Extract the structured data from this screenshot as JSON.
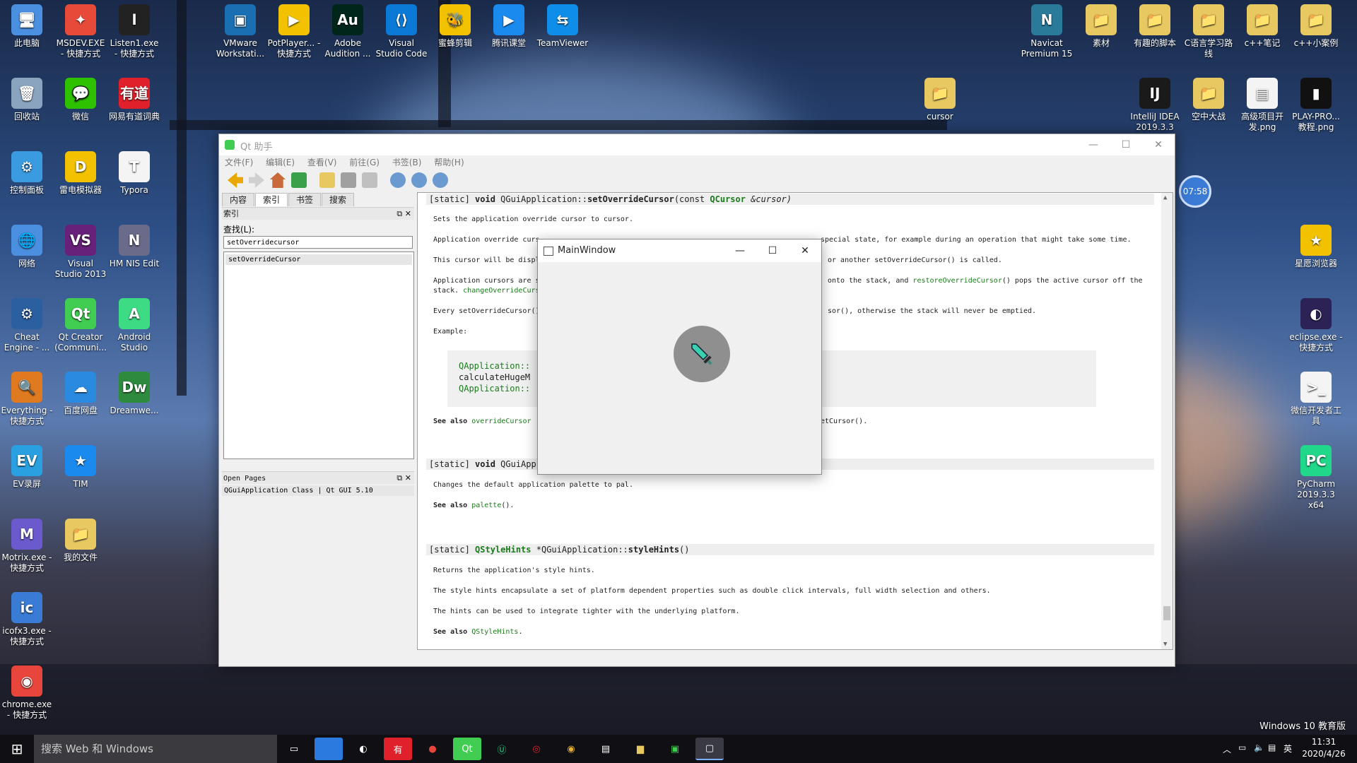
{
  "colors": {
    "accent": "#1b7b1b",
    "taskbar": "#101014",
    "qt_green": "#41cd52"
  },
  "desktop_icons": [
    {
      "label": "此电脑",
      "color": "#4a8fe0",
      "glyph": "🖥"
    },
    {
      "label": "MSDEV.EXE - 快捷方式",
      "color": "#e84a3a",
      "glyph": "✦"
    },
    {
      "label": "Listen1.exe - 快捷方式",
      "color": "#222",
      "glyph": "l"
    },
    {
      "label": "回收站",
      "color": "#8aa4c0",
      "glyph": "🗑"
    },
    {
      "label": "微信",
      "color": "#2dc100",
      "glyph": "💬"
    },
    {
      "label": "网易有道词典",
      "color": "#e0202a",
      "glyph": "有道"
    },
    {
      "label": "控制面板",
      "color": "#3a9be0",
      "glyph": "⚙"
    },
    {
      "label": "雷电模拟器",
      "color": "#f2c200",
      "glyph": "D"
    },
    {
      "label": "Typora",
      "color": "#f4f4f4",
      "glyph": "T"
    },
    {
      "label": "网络",
      "color": "#4a8fe0",
      "glyph": "🌐"
    },
    {
      "label": "Visual Studio 2013",
      "color": "#68217a",
      "glyph": "VS"
    },
    {
      "label": "HM NIS Edit",
      "color": "#6a6a8a",
      "glyph": "N"
    },
    {
      "label": "Cheat Engine - ...",
      "color": "#2a5fa0",
      "glyph": "⚙"
    },
    {
      "label": "Qt Creator (Communi...",
      "color": "#41cd52",
      "glyph": "Qt"
    },
    {
      "label": "Android Studio",
      "color": "#3ddc84",
      "glyph": "A"
    },
    {
      "label": "Everything - 快捷方式",
      "color": "#e07a20",
      "glyph": "🔍"
    },
    {
      "label": "百度网盘",
      "color": "#2a8ae0",
      "glyph": "☁"
    },
    {
      "label": "Dreamwe...",
      "color": "#2e8b3e",
      "glyph": "Dw"
    },
    {
      "label": "EV录屏",
      "color": "#2aa0e0",
      "glyph": "EV"
    },
    {
      "label": "TIM",
      "color": "#1a8aef",
      "glyph": "★"
    },
    {
      "label": "Motrix.exe - 快捷方式",
      "color": "#6a5acd",
      "glyph": "M"
    },
    {
      "label": "我的文件",
      "color": "#e8c860",
      "glyph": "📁"
    },
    {
      "label": "icofx3.exe - 快捷方式",
      "color": "#3a7bd5",
      "glyph": "ic"
    },
    {
      "label": "chrome.exe - 快捷方式",
      "color": "#e8453c",
      "glyph": "◉"
    },
    {
      "label": "VMware Workstati...",
      "color": "#1a6fb3",
      "glyph": "▣"
    },
    {
      "label": "PotPlayer... - 快捷方式",
      "color": "#f2c200",
      "glyph": "▶"
    },
    {
      "label": "Adobe Audition ...",
      "color": "#00261c",
      "glyph": "Au"
    },
    {
      "label": "Visual Studio Code",
      "color": "#0a7ad6",
      "glyph": "⟨⟩"
    },
    {
      "label": "蜜蜂剪辑",
      "color": "#f2c200",
      "glyph": "🐝"
    },
    {
      "label": "腾讯课堂",
      "color": "#1a8aef",
      "glyph": "▶"
    },
    {
      "label": "TeamViewer",
      "color": "#0e8ee9",
      "glyph": "⇆"
    },
    {
      "label": "Navicat Premium 15",
      "color": "#2a7a9a",
      "glyph": "N"
    },
    {
      "label": "素材",
      "color": "#e8c860",
      "glyph": "📁"
    },
    {
      "label": "有趣的脚本",
      "color": "#e8c860",
      "glyph": "📁"
    },
    {
      "label": "C语言学习路线",
      "color": "#e8c860",
      "glyph": "📁"
    },
    {
      "label": "c++笔记",
      "color": "#e8c860",
      "glyph": "📁"
    },
    {
      "label": "c++小案例",
      "color": "#e8c860",
      "glyph": "📁"
    },
    {
      "label": "cursor",
      "color": "#e8c860",
      "glyph": "📁"
    },
    {
      "label": "IntelliJ IDEA 2019.3.3 x64",
      "color": "#1a1a1a",
      "glyph": "IJ"
    },
    {
      "label": "空中大战",
      "color": "#e8c860",
      "glyph": "📁"
    },
    {
      "label": "高级项目开发.png",
      "color": "#f4f4f4",
      "glyph": "▤"
    },
    {
      "label": "PLAY-PRO... 教程.png",
      "color": "#111",
      "glyph": "▮"
    },
    {
      "label": "星愿浏览器",
      "color": "#f2c200",
      "glyph": "★"
    },
    {
      "label": "eclipse.exe - 快捷方式",
      "color": "#2c2255",
      "glyph": "◐"
    },
    {
      "label": "微信开发者工具",
      "color": "#f4f4f4",
      "glyph": ">_"
    },
    {
      "label": "PyCharm 2019.3.3 x64",
      "color": "#21d789",
      "glyph": "PC"
    }
  ],
  "timer_badge": "07:58",
  "qt_window": {
    "title": "Qt 助手",
    "menu": [
      "文件(F)",
      "编辑(E)",
      "查看(V)",
      "前往(G)",
      "书签(B)",
      "帮助(H)"
    ],
    "left_tabs": [
      "内容",
      "索引",
      "书签",
      "搜索"
    ],
    "index_pane_title": "索引",
    "find_label": "查找(L):",
    "find_value": "setOverridecursor",
    "index_items": [
      "setOverrideCursor"
    ],
    "open_pages_title": "Open Pages",
    "open_pages_items": [
      "QGuiApplication Class | Qt GUI 5.10"
    ]
  },
  "doc": {
    "h1": {
      "prefix": "[static] ",
      "ret": "void ",
      "cls": "QGuiApplication::",
      "fn": "setOverrideCursor",
      "args_pre": "(const ",
      "type": "QCursor",
      "args_post": " &cursor)"
    },
    "l1": "Sets the application override cursor to cursor.",
    "l2a": "Application override curs",
    "l2b": "special state, for example during an operation that might take some time.",
    "l3a": "This cursor will be displ",
    "l3b": "or another setOverrideCursor() is called.",
    "l4a": "Application cursors are s",
    "l4b": "onto the stack, and ",
    "l4link": "restoreOverrideCursor",
    "l4c": "() pops the active cursor off the",
    "l5a": "stack. ",
    "l5link": "changeOverrideCurs",
    "l6a": "Every setOverrideCursor()",
    "l6b": "sor(), otherwise the stack will never be emptied.",
    "example": "Example:",
    "code1": "QApplication::",
    "code2": "calculateHugeM",
    "code3": "QApplication::",
    "seealso1": "See also",
    "seealso1_link": "overrideCursor",
    "seealso1_tail": "etCursor().",
    "h2": {
      "prefix": "[static] ",
      "ret": "void ",
      "cls": "QGuiApp"
    },
    "l7": "Changes the default application palette to pal.",
    "seealso2": "See also",
    "seealso2_link": "palette",
    "seealso2_tail": "().",
    "h3": {
      "prefix": "[static] ",
      "type": "QStyleHints",
      "cls": " *QGuiApplication::",
      "fn": "styleHints",
      "args": "()"
    },
    "l8": "Returns the application's style hints.",
    "l9": "The style hints encapsulate a set of platform dependent properties such as double click intervals, full width selection and others.",
    "l10": "The hints can be used to integrate tighter with the underlying platform.",
    "seealso3": "See also",
    "seealso3_link": "QStyleHints",
    "seealso3_tail": "."
  },
  "main_window": {
    "title": "MainWindow",
    "cursor_icon": "sword-cursor-icon"
  },
  "taskbar": {
    "search_placeholder": "搜索 Web 和 Windows",
    "tray_lang": "英",
    "time": "11:31",
    "date": "2020/4/26",
    "edition": "Windows 10 教育版"
  }
}
